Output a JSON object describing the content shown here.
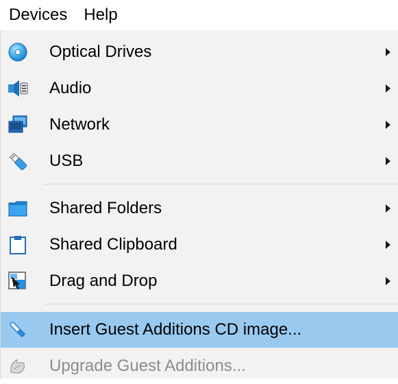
{
  "menubar": {
    "devices_label": "Devices",
    "help_label": "Help"
  },
  "menu": {
    "items": [
      {
        "label": "Optical Drives",
        "icon": "optical-disc-icon",
        "submenu": true,
        "enabled": true
      },
      {
        "label": "Audio",
        "icon": "speaker-icon",
        "submenu": true,
        "enabled": true
      },
      {
        "label": "Network",
        "icon": "network-icon",
        "submenu": true,
        "enabled": true
      },
      {
        "label": "USB",
        "icon": "usb-plug-icon",
        "submenu": true,
        "enabled": true
      },
      {
        "label": "Shared Folders",
        "icon": "folder-icon",
        "submenu": true,
        "enabled": true
      },
      {
        "label": "Shared Clipboard",
        "icon": "clipboard-icon",
        "submenu": true,
        "enabled": true
      },
      {
        "label": "Drag and Drop",
        "icon": "drag-drop-icon",
        "submenu": true,
        "enabled": true
      },
      {
        "label": "Insert Guest Additions CD image...",
        "icon": "guest-additions-cd-icon",
        "submenu": false,
        "enabled": true,
        "highlighted": true
      },
      {
        "label": "Upgrade Guest Additions...",
        "icon": "upgrade-additions-icon",
        "submenu": false,
        "enabled": false
      }
    ]
  },
  "colors": {
    "menu_background": "#f2f2f2",
    "highlight": "#99c9ef",
    "disabled_text": "#8c8c8c",
    "separator": "#d5d5d5"
  }
}
